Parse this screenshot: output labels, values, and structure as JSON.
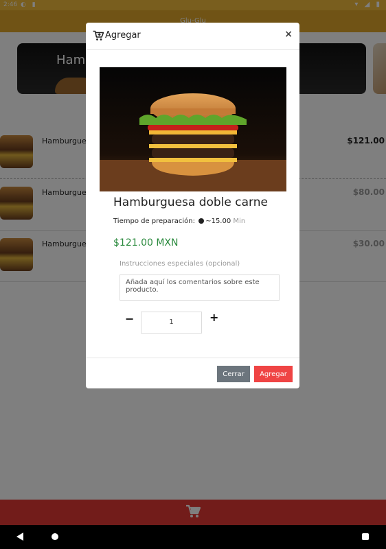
{
  "status": {
    "time": "2:46"
  },
  "app": {
    "title": "Glu-Glu"
  },
  "categories": [
    {
      "label": "Hamburguesas"
    },
    {
      "label": ""
    }
  ],
  "products": [
    {
      "name": "Hamburguesa doble carne",
      "name_short": "Hamburgues",
      "price": "$121.00"
    },
    {
      "name": "Hamburguesa",
      "name_short": "Hamburgues",
      "price": "$80.00"
    },
    {
      "name": "Hamburguesa",
      "name_short": "Hamburgues",
      "price": "$30.00"
    }
  ],
  "modal": {
    "title": "Agregar",
    "product_name": "Hamburguesa doble carne",
    "prep_label": "Tiempo de preparación:",
    "prep_value": "~15.00",
    "prep_unit": "Min",
    "price": "$121.00 MXN",
    "instructions_label": "Instrucciones especiales (opcional)",
    "instructions_placeholder": "Añada aquí los comentarios sobre este producto.",
    "quantity": "1",
    "minus_label": "−",
    "plus_label": "+",
    "close_label": "Cerrar",
    "add_label": "Agregar"
  },
  "colors": {
    "brand": "#f2bc3c",
    "price_green": "#2b8a3e",
    "add_red": "#ef4444",
    "cart_red": "#e53935",
    "close_gray": "#6c757d"
  }
}
